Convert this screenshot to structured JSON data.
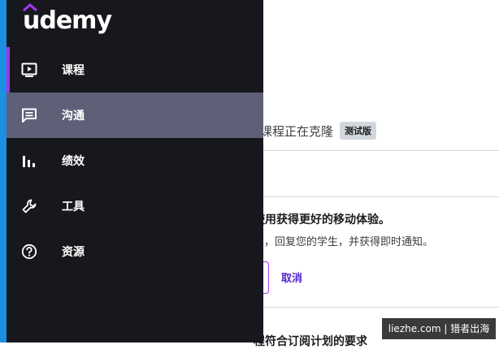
{
  "app": {
    "logo_text": "udemy"
  },
  "sidebar": {
    "items": [
      {
        "label": "课程",
        "icon": "video-screen-icon"
      },
      {
        "label": "沟通",
        "icon": "message-icon"
      },
      {
        "label": "绩效",
        "icon": "bar-chart-icon"
      },
      {
        "label": "工具",
        "icon": "wrench-icon"
      },
      {
        "label": "资源",
        "icon": "help-circle-icon"
      }
    ]
  },
  "main": {
    "notice_text": "课程正在克隆",
    "beta_badge": "测试版",
    "promo_title": "使用获得更好的移动体验。",
    "promo_subtitle": "练，回复您的学生，并获得即时通知。",
    "cancel_label": "取消",
    "bottom_text": "程符合订阅计划的要求"
  },
  "watermark": "liezhe.com | 猎者出海",
  "colors": {
    "drawer_bg": "#17181d",
    "hover_bg": "#5f6078",
    "accent_purple": "#a435f0",
    "link_purple": "#5624d0",
    "left_stripe": "#1b8fe0"
  }
}
